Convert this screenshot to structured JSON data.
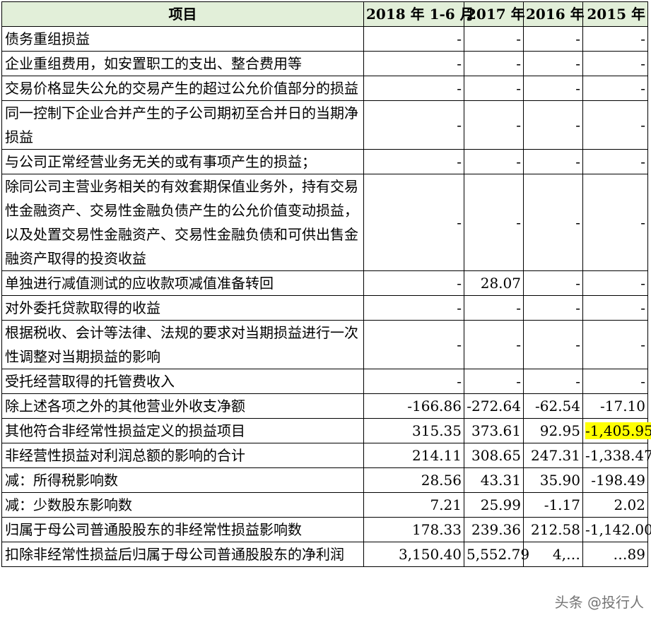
{
  "table": {
    "headers": [
      "项目",
      "2018 年 1-6 月",
      "2017 年",
      "2016 年",
      "2015 年"
    ],
    "rows": [
      {
        "item": "债务重组损益",
        "values": [
          "-",
          "-",
          "-",
          "-"
        ]
      },
      {
        "item": "企业重组费用，如安置职工的支出、整合费用等",
        "values": [
          "-",
          "-",
          "-",
          "-"
        ]
      },
      {
        "item": "交易价格显失公允的交易产生的超过公允价值部分的损益",
        "values": [
          "-",
          "-",
          "-",
          "-"
        ]
      },
      {
        "item": "同一控制下企业合并产生的子公司期初至合并日的当期净损益",
        "values": [
          "-",
          "-",
          "-",
          "-"
        ]
      },
      {
        "item": "与公司正常经营业务无关的或有事项产生的损益；",
        "values": [
          "-",
          "-",
          "-",
          "-"
        ]
      },
      {
        "item": "除同公司主营业务相关的有效套期保值业务外，持有交易性金融资产、交易性金融负债产生的公允价值变动损益，以及处置交易性金融资产、交易性金融负债和可供出售金融资产取得的投资收益",
        "values": [
          "-",
          "-",
          "-",
          "-"
        ]
      },
      {
        "item": "单独进行减值测试的应收款项减值准备转回",
        "values": [
          "-",
          "28.07",
          "-",
          "-"
        ]
      },
      {
        "item": "对外委托贷款取得的收益",
        "values": [
          "-",
          "-",
          "-",
          "-"
        ]
      },
      {
        "item": "根据税收、会计等法律、法规的要求对当期损益进行一次性调整对当期损益的影响",
        "values": [
          "-",
          "-",
          "-",
          "-"
        ]
      },
      {
        "item": "受托经营取得的托管费收入",
        "values": [
          "-",
          "-",
          "-",
          "-"
        ]
      },
      {
        "item": "除上述各项之外的其他营业外收支净额",
        "values": [
          "-166.86",
          "-272.64",
          "-62.54",
          "-17.10"
        ]
      },
      {
        "item": "其他符合非经常性损益定义的损益项目",
        "values": [
          "315.35",
          "373.61",
          "92.95",
          "-1,405.95"
        ]
      },
      {
        "item": "非经营性损益对利润总额的影响的合计",
        "values": [
          "214.11",
          "308.65",
          "247.31",
          "-1,338.47"
        ]
      },
      {
        "item": "减：所得税影响数",
        "values": [
          "28.56",
          "43.31",
          "35.90",
          "-198.49"
        ]
      },
      {
        "item": "减：少数股东影响数",
        "values": [
          "7.21",
          "25.99",
          "-1.17",
          "2.02"
        ]
      },
      {
        "item": "归属于母公司普通股股东的非经常性损益影响数",
        "values": [
          "178.33",
          "239.36",
          "212.58",
          "-1,142.00"
        ]
      },
      {
        "item": "扣除非经常性损益后归属于母公司普通股股东的净利润",
        "values": [
          "3,150.40",
          "5,552.79",
          "4,…",
          "…89"
        ]
      }
    ]
  },
  "highlight_color": "#ffff00",
  "header_bg": "#e2efd9",
  "watermark": "头条 @投行人"
}
